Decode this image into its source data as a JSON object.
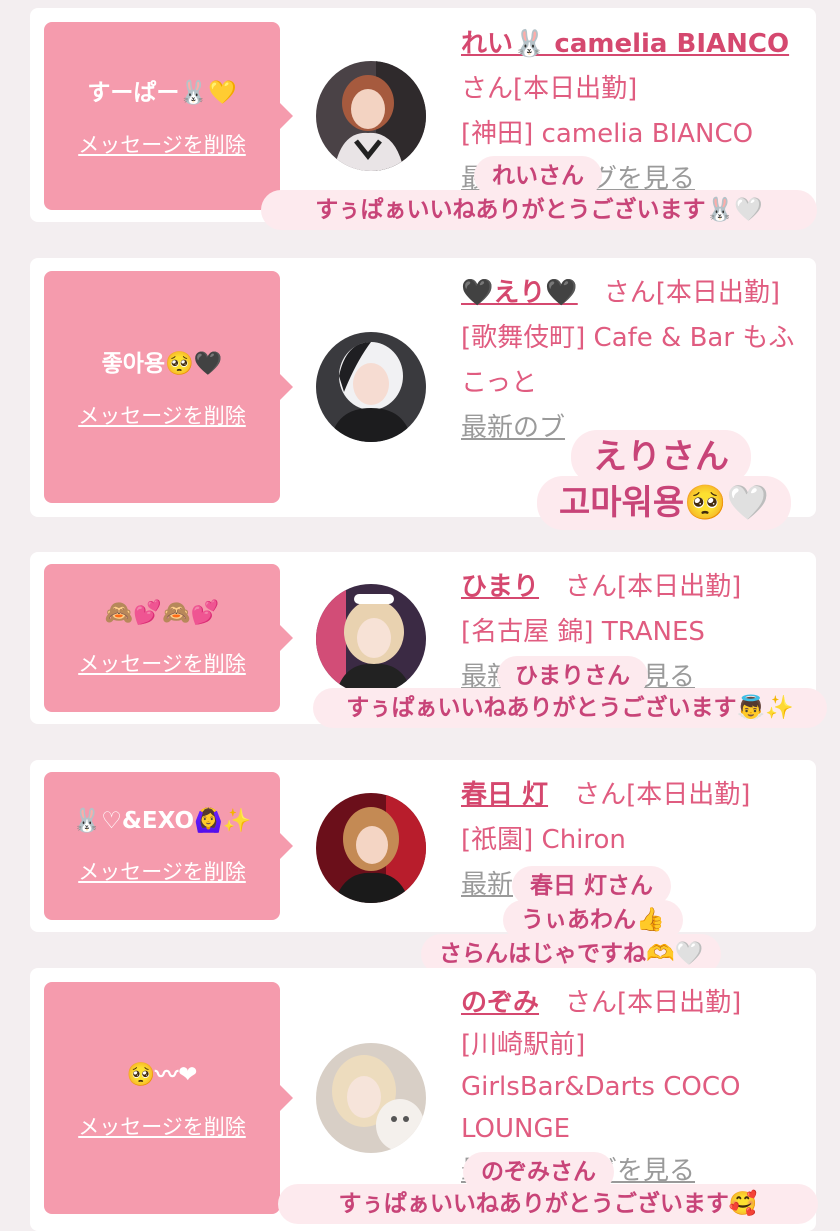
{
  "cards": [
    {
      "message": "すーぱー🐰💛",
      "delete_label": "メッセージを削除",
      "name": "れい🐰 camelia BIANCO",
      "suffix": "さん[本日出勤]",
      "location": "[神田] camelia BIANCO",
      "latest": "最新のブログを見る",
      "sticker_name": "れいさん",
      "sticker_msg": "すぅぱぁいいねありがとうございます🐰🤍"
    },
    {
      "message": "좋아용🥺🖤",
      "delete_label": "メッセージを削除",
      "name": "🖤えり🖤",
      "suffix": "さん[本日出勤]",
      "location": "[歌舞伎町] Cafe & Bar もふこっと",
      "latest": "最新のブ",
      "sticker_name": "えりさん",
      "sticker_msg": "고마워용🥺🤍"
    },
    {
      "message": "🙈💕🙈💕",
      "delete_label": "メッセージを削除",
      "name": "ひまり",
      "suffix": "さん[本日出勤]",
      "location": "[名古屋 錦] TRANES",
      "latest": "最新のブログを見る",
      "sticker_name": "ひまりさん",
      "sticker_msg": "すぅぱぁいいねありがとうございます👼✨"
    },
    {
      "message": "🐰♡&EXO🙆‍♀️✨",
      "delete_label": "メッセージを削除",
      "name": "春日 灯",
      "suffix": "さん[本日出勤]",
      "location": "[祇園] Chiron",
      "latest": "最新",
      "sticker_name": "春日 灯さん",
      "sticker_line2": "うぃあわん👍",
      "sticker_msg": "さらんはじゃですね🫶🤍"
    },
    {
      "message": "🥺〰❤",
      "delete_label": "メッセージを削除",
      "name": "のぞみ",
      "suffix": "さん[本日出勤]",
      "location": "[川崎駅前] GirlsBar&Darts COCO LOUNGE",
      "latest": "最新のブログを見る",
      "sticker_name": "のぞみさん",
      "sticker_msg": "すぅぱぁいいねありがとうございます🥰"
    }
  ],
  "colors": {
    "accent": "#f59bad",
    "name": "#d5486f",
    "text": "#e05c80"
  }
}
